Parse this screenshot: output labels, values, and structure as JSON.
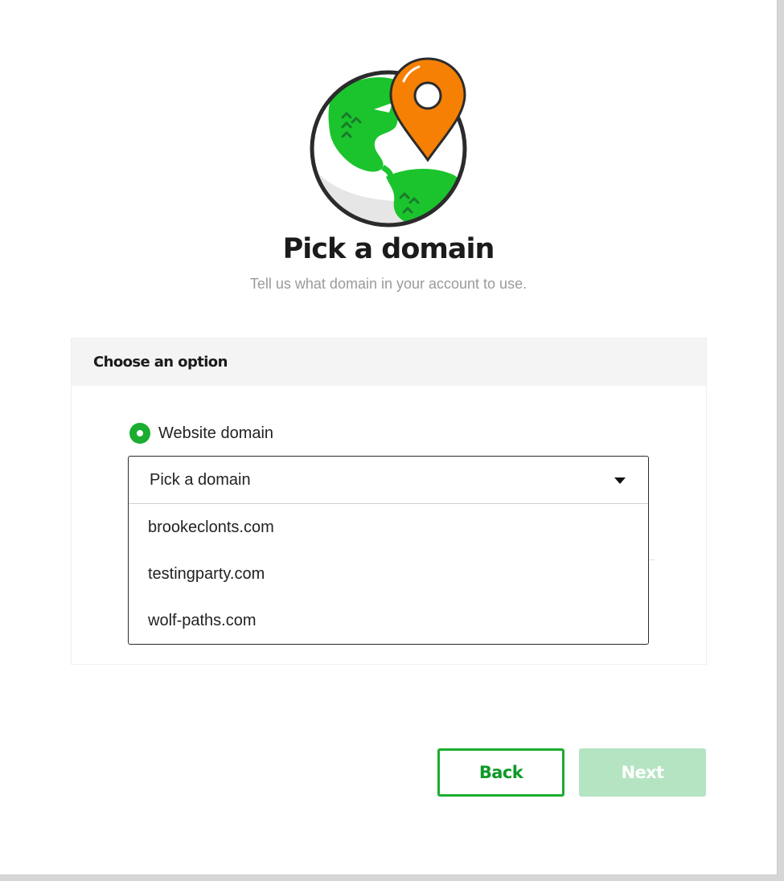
{
  "header": {
    "title": "Pick a domain",
    "subtitle": "Tell us what domain in your account to use."
  },
  "option_card": {
    "heading": "Choose an option",
    "radio_label": "Website domain",
    "dropdown": {
      "selected": "Pick a domain",
      "options": [
        "brookeclonts.com",
        "testingparty.com",
        "wolf-paths.com"
      ]
    }
  },
  "actions": {
    "back_label": "Back",
    "next_label": "Next"
  },
  "colors": {
    "brand_green": "#1bad2f",
    "pin_orange": "#f58003",
    "next_disabled": "#b5e4c3"
  },
  "icons": {
    "illustration": "globe-location-pin-icon",
    "dropdown_caret": "caret-down-icon"
  }
}
